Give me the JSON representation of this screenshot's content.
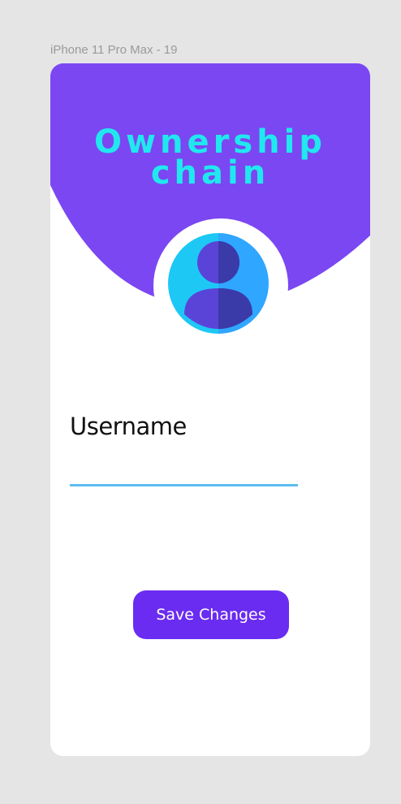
{
  "frame": {
    "label": "iPhone 11 Pro Max - 19"
  },
  "header": {
    "title_line1": "Ownership",
    "title_line2": "chain",
    "bg_color": "#7b47f2",
    "title_color": "#20e8ee"
  },
  "avatar": {
    "icon": "user-avatar-icon"
  },
  "form": {
    "username_label": "Username",
    "username_value": "",
    "underline_color": "#5dbcf0"
  },
  "actions": {
    "save_label": "Save  Changes",
    "button_color": "#6a2cf0"
  }
}
